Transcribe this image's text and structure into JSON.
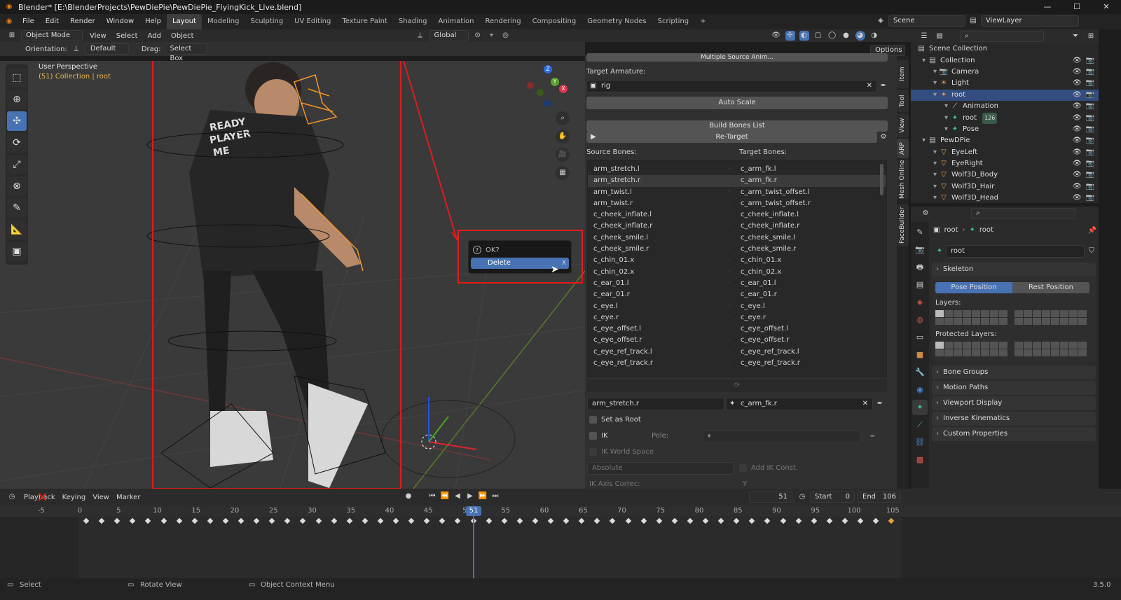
{
  "title": "Blender* [E:\\BlenderProjects\\PewDiePie\\PewDiePie_FlyingKick_Live.blend]",
  "menu": [
    "File",
    "Edit",
    "Render",
    "Window",
    "Help"
  ],
  "workspaces": [
    "Layout",
    "Modeling",
    "Sculpting",
    "UV Editing",
    "Texture Paint",
    "Shading",
    "Animation",
    "Rendering",
    "Compositing",
    "Geometry Nodes",
    "Scripting",
    "+"
  ],
  "scene": "Scene",
  "view_layer": "ViewLayer",
  "viewport_header": {
    "mode": "Object Mode",
    "menus": [
      "View",
      "Select",
      "Add",
      "Object"
    ],
    "transform": "Global"
  },
  "tool_header": {
    "orientation_label": "Orientation:",
    "orientation": "Default",
    "drag_label": "Drag:",
    "drag": "Select Box",
    "options": "Options"
  },
  "overlay_text": {
    "perspective": "User Perspective",
    "collection": "(51) Collection | root"
  },
  "gizmo": {
    "x": "X",
    "y": "Y",
    "z": "Z"
  },
  "npanel": {
    "top_button": "Multiple Source Anim...",
    "target_armature_label": "Target Armature:",
    "target_armature": "rig",
    "auto_scale": "Auto Scale",
    "build_bones": "Build Bones List",
    "retarget": "Re-Target",
    "source_header": "Source Bones:",
    "target_header": "Target Bones:",
    "bones": [
      {
        "s": "arm_stretch.l",
        "t": "c_arm_fk.l"
      },
      {
        "s": "arm_stretch.r",
        "t": "c_arm_fk.r"
      },
      {
        "s": "arm_twist.l",
        "t": "c_arm_twist_offset.l"
      },
      {
        "s": "arm_twist.r",
        "t": "c_arm_twist_offset.r"
      },
      {
        "s": "c_cheek_inflate.l",
        "t": "c_cheek_inflate.l"
      },
      {
        "s": "c_cheek_inflate.r",
        "t": "c_cheek_inflate.r"
      },
      {
        "s": "c_cheek_smile.l",
        "t": "c_cheek_smile.l"
      },
      {
        "s": "c_cheek_smile.r",
        "t": "c_cheek_smile.r"
      },
      {
        "s": "c_chin_01.x",
        "t": "c_chin_01.x"
      },
      {
        "s": "c_chin_02.x",
        "t": "c_chin_02.x"
      },
      {
        "s": "c_ear_01.l",
        "t": "c_ear_01.l"
      },
      {
        "s": "c_ear_01.r",
        "t": "c_ear_01.r"
      },
      {
        "s": "c_eye.l",
        "t": "c_eye.l"
      },
      {
        "s": "c_eye.r",
        "t": "c_eye.r"
      },
      {
        "s": "c_eye_offset.l",
        "t": "c_eye_offset.l"
      },
      {
        "s": "c_eye_offset.r",
        "t": "c_eye_offset.r"
      },
      {
        "s": "c_eye_ref_track.l",
        "t": "c_eye_ref_track.l"
      },
      {
        "s": "c_eye_ref_track.r",
        "t": "c_eye_ref_track.r"
      }
    ],
    "sel_source": "arm_stretch.r",
    "sel_target": "c_arm_fk.r",
    "set_as_root": "Set as Root",
    "ik": "IK",
    "pole": "Pole:",
    "ik_world_space": "IK World Space",
    "absolute": "Absolute",
    "add_ik_const": "Add IK Const.",
    "ik_axis": "IK Axis Correc:",
    "ik_axis_val": "Y"
  },
  "vtabs": [
    "Item",
    "Tool",
    "View",
    "ARP",
    "Mesh Online",
    "FaceBuilder"
  ],
  "popup": {
    "question": "OK?",
    "action": "Delete"
  },
  "outliner": [
    {
      "label": "Scene Collection",
      "indent": 0
    },
    {
      "label": "Collection",
      "indent": 1
    },
    {
      "label": "Camera",
      "indent": 2
    },
    {
      "label": "Light",
      "indent": 2
    },
    {
      "label": "root",
      "indent": 2,
      "sel": true
    },
    {
      "label": "Animation",
      "indent": 3
    },
    {
      "label": "root",
      "indent": 3
    },
    {
      "label": "Pose",
      "indent": 3
    },
    {
      "label": "PewDPie",
      "indent": 1
    },
    {
      "label": "EyeLeft",
      "indent": 2
    },
    {
      "label": "EyeRight",
      "indent": 2
    },
    {
      "label": "Wolf3D_Body",
      "indent": 2
    },
    {
      "label": "Wolf3D_Hair",
      "indent": 2
    },
    {
      "label": "Wolf3D_Head",
      "indent": 2
    }
  ],
  "outliner_badge": "126",
  "properties": {
    "breadcrumb_a": "root",
    "breadcrumb_b": "root",
    "name": "root",
    "skeleton": "Skeleton",
    "pose_position": "Pose Position",
    "rest_position": "Rest Position",
    "layers": "Layers:",
    "protected_layers": "Protected Layers:",
    "panels": [
      "Bone Groups",
      "Motion Paths",
      "Viewport Display",
      "Inverse Kinematics",
      "Custom Properties"
    ]
  },
  "timeline": {
    "menus": [
      "Playback",
      "Keying",
      "View",
      "Marker"
    ],
    "current_frame": "51",
    "start_label": "Start",
    "start": "0",
    "end_label": "End",
    "end": "106",
    "ruler": [
      "-5",
      "0",
      "5",
      "10",
      "15",
      "20",
      "25",
      "30",
      "35",
      "40",
      "45",
      "50",
      "55",
      "60",
      "65",
      "70",
      "75",
      "80",
      "85",
      "90",
      "95",
      "100",
      "105"
    ]
  },
  "status": {
    "select": "Select",
    "rotate": "Rotate View",
    "context": "Object Context Menu",
    "version": "3.5.0"
  }
}
